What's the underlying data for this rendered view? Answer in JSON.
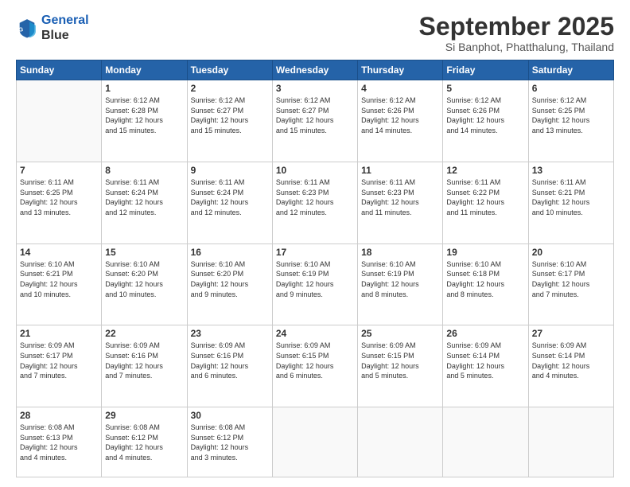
{
  "logo": {
    "line1": "General",
    "line2": "Blue"
  },
  "title": "September 2025",
  "subtitle": "Si Banphot, Phatthalung, Thailand",
  "days_of_week": [
    "Sunday",
    "Monday",
    "Tuesday",
    "Wednesday",
    "Thursday",
    "Friday",
    "Saturday"
  ],
  "weeks": [
    [
      null,
      {
        "day": 1,
        "sunrise": "6:12 AM",
        "sunset": "6:28 PM",
        "daylight": "12 hours and 15 minutes."
      },
      {
        "day": 2,
        "sunrise": "6:12 AM",
        "sunset": "6:27 PM",
        "daylight": "12 hours and 15 minutes."
      },
      {
        "day": 3,
        "sunrise": "6:12 AM",
        "sunset": "6:27 PM",
        "daylight": "12 hours and 15 minutes."
      },
      {
        "day": 4,
        "sunrise": "6:12 AM",
        "sunset": "6:26 PM",
        "daylight": "12 hours and 14 minutes."
      },
      {
        "day": 5,
        "sunrise": "6:12 AM",
        "sunset": "6:26 PM",
        "daylight": "12 hours and 14 minutes."
      },
      {
        "day": 6,
        "sunrise": "6:12 AM",
        "sunset": "6:25 PM",
        "daylight": "12 hours and 13 minutes."
      }
    ],
    [
      {
        "day": 7,
        "sunrise": "6:11 AM",
        "sunset": "6:25 PM",
        "daylight": "12 hours and 13 minutes."
      },
      {
        "day": 8,
        "sunrise": "6:11 AM",
        "sunset": "6:24 PM",
        "daylight": "12 hours and 12 minutes."
      },
      {
        "day": 9,
        "sunrise": "6:11 AM",
        "sunset": "6:24 PM",
        "daylight": "12 hours and 12 minutes."
      },
      {
        "day": 10,
        "sunrise": "6:11 AM",
        "sunset": "6:23 PM",
        "daylight": "12 hours and 12 minutes."
      },
      {
        "day": 11,
        "sunrise": "6:11 AM",
        "sunset": "6:23 PM",
        "daylight": "12 hours and 11 minutes."
      },
      {
        "day": 12,
        "sunrise": "6:11 AM",
        "sunset": "6:22 PM",
        "daylight": "12 hours and 11 minutes."
      },
      {
        "day": 13,
        "sunrise": "6:11 AM",
        "sunset": "6:21 PM",
        "daylight": "12 hours and 10 minutes."
      }
    ],
    [
      {
        "day": 14,
        "sunrise": "6:10 AM",
        "sunset": "6:21 PM",
        "daylight": "12 hours and 10 minutes."
      },
      {
        "day": 15,
        "sunrise": "6:10 AM",
        "sunset": "6:20 PM",
        "daylight": "12 hours and 10 minutes."
      },
      {
        "day": 16,
        "sunrise": "6:10 AM",
        "sunset": "6:20 PM",
        "daylight": "12 hours and 9 minutes."
      },
      {
        "day": 17,
        "sunrise": "6:10 AM",
        "sunset": "6:19 PM",
        "daylight": "12 hours and 9 minutes."
      },
      {
        "day": 18,
        "sunrise": "6:10 AM",
        "sunset": "6:19 PM",
        "daylight": "12 hours and 8 minutes."
      },
      {
        "day": 19,
        "sunrise": "6:10 AM",
        "sunset": "6:18 PM",
        "daylight": "12 hours and 8 minutes."
      },
      {
        "day": 20,
        "sunrise": "6:10 AM",
        "sunset": "6:17 PM",
        "daylight": "12 hours and 7 minutes."
      }
    ],
    [
      {
        "day": 21,
        "sunrise": "6:09 AM",
        "sunset": "6:17 PM",
        "daylight": "12 hours and 7 minutes."
      },
      {
        "day": 22,
        "sunrise": "6:09 AM",
        "sunset": "6:16 PM",
        "daylight": "12 hours and 7 minutes."
      },
      {
        "day": 23,
        "sunrise": "6:09 AM",
        "sunset": "6:16 PM",
        "daylight": "12 hours and 6 minutes."
      },
      {
        "day": 24,
        "sunrise": "6:09 AM",
        "sunset": "6:15 PM",
        "daylight": "12 hours and 6 minutes."
      },
      {
        "day": 25,
        "sunrise": "6:09 AM",
        "sunset": "6:15 PM",
        "daylight": "12 hours and 5 minutes."
      },
      {
        "day": 26,
        "sunrise": "6:09 AM",
        "sunset": "6:14 PM",
        "daylight": "12 hours and 5 minutes."
      },
      {
        "day": 27,
        "sunrise": "6:09 AM",
        "sunset": "6:14 PM",
        "daylight": "12 hours and 4 minutes."
      }
    ],
    [
      {
        "day": 28,
        "sunrise": "6:08 AM",
        "sunset": "6:13 PM",
        "daylight": "12 hours and 4 minutes."
      },
      {
        "day": 29,
        "sunrise": "6:08 AM",
        "sunset": "6:12 PM",
        "daylight": "12 hours and 4 minutes."
      },
      {
        "day": 30,
        "sunrise": "6:08 AM",
        "sunset": "6:12 PM",
        "daylight": "12 hours and 3 minutes."
      },
      null,
      null,
      null,
      null
    ]
  ]
}
